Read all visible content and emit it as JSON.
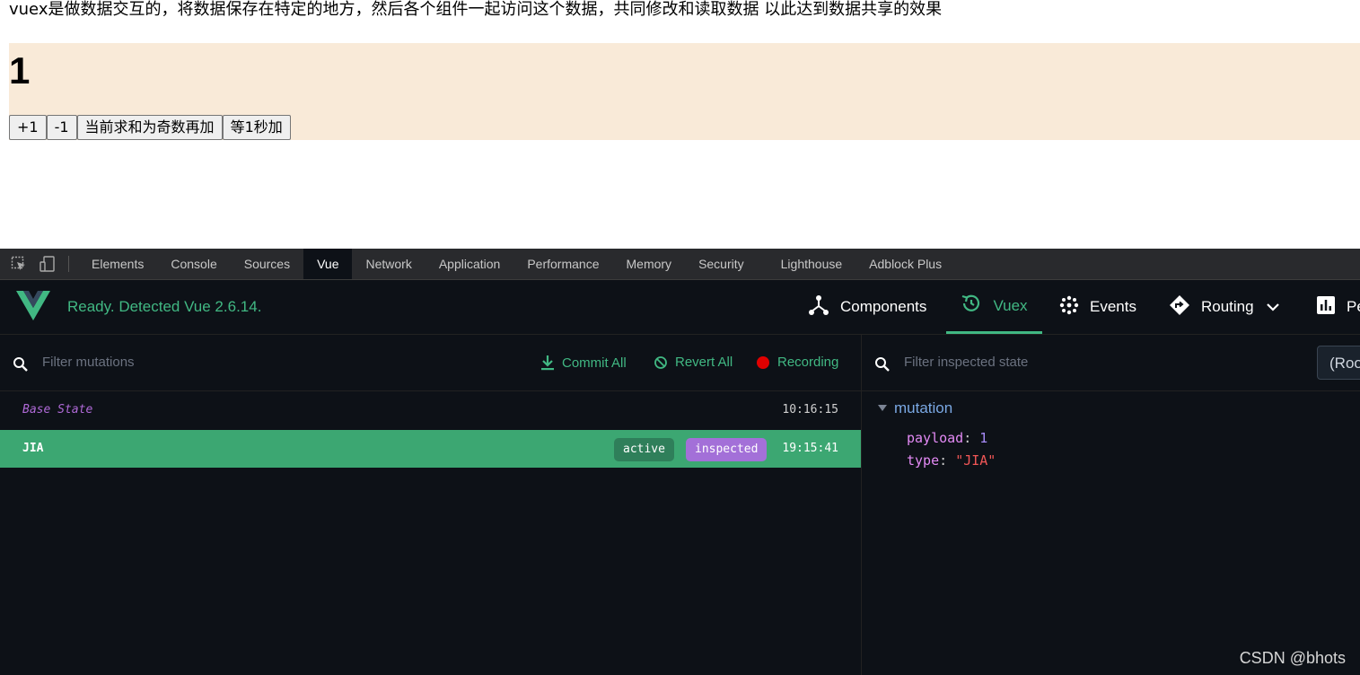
{
  "page": {
    "intro_text": "vuex是做数据交互的，将数据保存在特定的地方，然后各个组件一起访问这个数据，共同修改和读取数据 以此达到数据共享的效果",
    "count": "1",
    "buttons": [
      "+1",
      "-1",
      "当前求和为奇数再加",
      "等1秒加"
    ],
    "counter_bg": "#f9ead8"
  },
  "devtools": {
    "tabs": [
      "Elements",
      "Console",
      "Sources",
      "Vue",
      "Network",
      "Application",
      "Performance",
      "Memory",
      "Security",
      "Lighthouse",
      "Adblock Plus"
    ],
    "active_tab": "Vue",
    "vue": {
      "status": "Ready. Detected Vue 2.6.14.",
      "nav": {
        "components": "Components",
        "vuex": "Vuex",
        "events": "Events",
        "routing": "Routing",
        "performance_partial": "Pe"
      },
      "accent": "#41b883",
      "mutations": {
        "filter_placeholder": "Filter mutations",
        "commit_all": "Commit All",
        "revert_all": "Revert All",
        "recording": "Recording",
        "items": [
          {
            "name": "Base State",
            "time": "10:16:15"
          },
          {
            "name": "JIA",
            "badges": [
              "active",
              "inspected"
            ],
            "time": "19:15:41"
          }
        ]
      },
      "state": {
        "filter_placeholder": "Filter inspected state",
        "root_button": "(Root)",
        "section": "mutation",
        "payload_key": "payload",
        "payload_value": "1",
        "type_key": "type",
        "type_value": "\"JIA\""
      }
    }
  },
  "watermark": "CSDN @bhots"
}
